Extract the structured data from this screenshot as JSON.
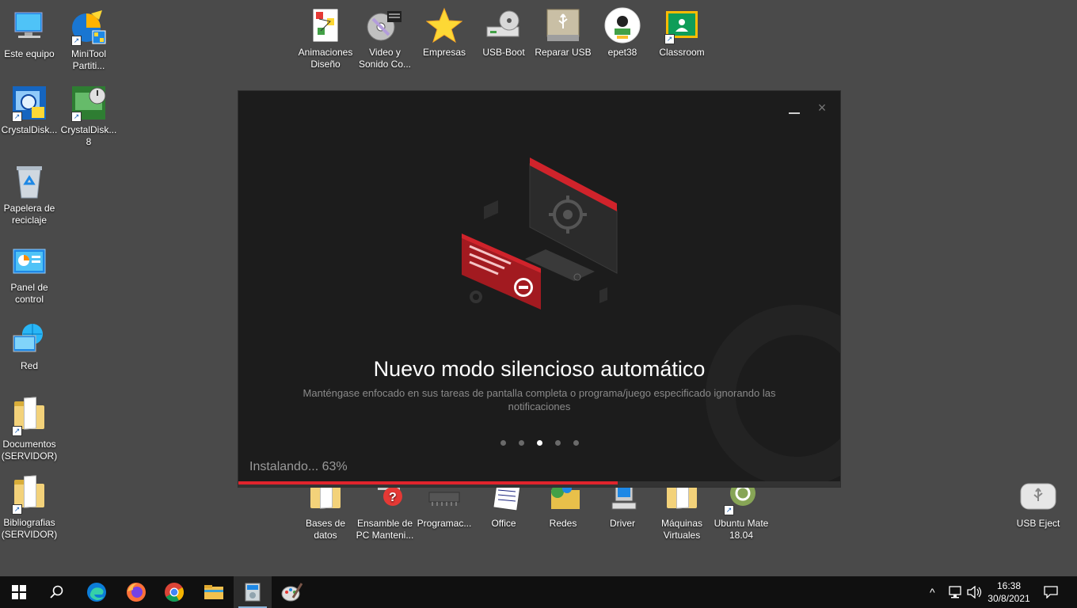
{
  "desktop": {
    "left_icons": [
      {
        "label": "Este equipo"
      },
      {
        "label": "MiniTool Partiti..."
      },
      {
        "label": "CrystalDisk..."
      },
      {
        "label": "CrystalDisk... 8"
      },
      {
        "label": "Papelera de reciclaje"
      },
      {
        "label": "Panel de control"
      },
      {
        "label": "Red"
      },
      {
        "label": "Documentos (SERVIDOR)"
      },
      {
        "label": "Bibliografias (SERVIDOR)"
      }
    ],
    "top_icons": [
      {
        "label": "Animaciones Diseño"
      },
      {
        "label": "Video y Sonido Co..."
      },
      {
        "label": "Empresas"
      },
      {
        "label": "USB-Boot"
      },
      {
        "label": "Reparar USB"
      },
      {
        "label": "epet38"
      },
      {
        "label": "Classroom"
      }
    ],
    "bottom_icons": [
      {
        "label": "Bases de datos"
      },
      {
        "label": "Ensamble de PC Manteni..."
      },
      {
        "label": "Programac..."
      },
      {
        "label": "Office"
      },
      {
        "label": "Redes"
      },
      {
        "label": "Driver"
      },
      {
        "label": "Máquinas Virtuales"
      },
      {
        "label": "Ubuntu Mate 18.04"
      }
    ],
    "right_icons": [
      {
        "label": "USB Eject"
      }
    ]
  },
  "installer": {
    "slide_title": "Nuevo modo silencioso automático",
    "slide_description": "Manténgase enfocado en sus tareas de pantalla completa o programa/juego especificado ignorando las notificaciones",
    "status_text": "Instalando... 63%",
    "progress_percent": 63,
    "slide_count": 5,
    "active_slide": 3,
    "close_glyph": "×",
    "accent_color": "#e0242c"
  },
  "taskbar": {
    "clock_time": "16:38",
    "clock_date": "30/8/2021",
    "tray_up_glyph": "^",
    "apps": [
      "start-icon",
      "search-icon",
      "edge-icon",
      "firefox-icon",
      "chrome-icon",
      "file-explorer-icon",
      "installer-app-icon",
      "paint-app-icon"
    ]
  }
}
